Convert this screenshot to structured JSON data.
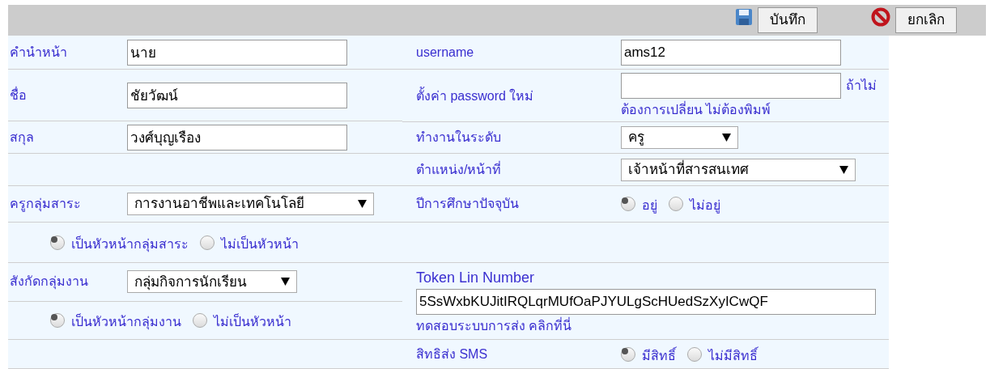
{
  "toolbar": {
    "save_label": "บันทึก",
    "cancel_label": "ยกเลิก"
  },
  "rows": [
    {
      "left": [
        {
          "kind": "field",
          "label": "คำนำหน้า",
          "control": {
            "kind": "input",
            "value": "นาย"
          }
        }
      ],
      "right": [
        {
          "kind": "field",
          "label": "username",
          "control": {
            "kind": "input",
            "value": "ams12"
          }
        }
      ]
    },
    {
      "left": [
        {
          "kind": "field",
          "label": "ชื่อ",
          "control": {
            "kind": "input",
            "value": "ชัยวัฒน์"
          }
        }
      ],
      "right": [
        {
          "kind": "field",
          "label": "ตั้งค่า password ใหม่",
          "control": {
            "kind": "password",
            "note": [
              "ถ้าไม่",
              "ต้องการเปลี่ยน ไม่ต้องพิมพ์"
            ]
          }
        }
      ]
    },
    {
      "left": [
        {
          "kind": "field",
          "label": "สกุล",
          "control": {
            "kind": "input",
            "value": "วงศ์บุญเรือง"
          }
        }
      ],
      "right": [
        {
          "kind": "field",
          "label": "ทำงานในระดับ",
          "control": {
            "kind": "select",
            "value": "ครู"
          }
        }
      ]
    },
    {
      "left": [
        {
          "kind": "empty"
        }
      ],
      "right": [
        {
          "kind": "field",
          "label": "ตำแหน่ง/หน้าที่",
          "control": {
            "kind": "select",
            "value": "เจ้าหน้าที่สารสนเทศ"
          }
        }
      ]
    },
    {
      "left": [
        {
          "kind": "field",
          "label": "ครูกลุ่มสาระ",
          "control": {
            "kind": "select",
            "value": "การงานอาชีพและเทคโนโลยี"
          }
        }
      ],
      "right": [
        {
          "kind": "field",
          "label": "ปีการศึกษาปัจจุบัน",
          "control": {
            "kind": "radios",
            "options": [
              {
                "label": "อยู่",
                "selected": true
              },
              {
                "label": "ไม่อยู่",
                "selected": false
              }
            ]
          }
        }
      ]
    },
    {
      "left": [
        {
          "kind": "radios",
          "options": [
            {
              "label": "เป็นหัวหน้ากลุ่มสาระ",
              "selected": true
            },
            {
              "label": "ไม่เป็นหัวหน้า",
              "selected": false
            }
          ]
        }
      ],
      "right": [
        {
          "kind": "empty"
        }
      ]
    },
    {
      "left": [
        {
          "kind": "field",
          "label": "สังกัดกลุ่มงาน",
          "control": {
            "kind": "select",
            "value": "กลุ่มกิจการนักเรียน"
          }
        },
        {
          "kind": "radios",
          "options": [
            {
              "label": "เป็นหัวหน้ากลุ่มงาน",
              "selected": true
            },
            {
              "label": "ไม่เป็นหัวหน้า",
              "selected": false
            }
          ]
        }
      ],
      "right": [
        {
          "kind": "token",
          "label": "Token Lin Number",
          "value": "5SsWxbKUJitIRQLqrMUfOaPJYULgScHUedSzXyICwQF",
          "link": "ทดสอบระบบการส่ง คลิกที่นี่"
        }
      ]
    },
    {
      "left": [
        {
          "kind": "empty"
        }
      ],
      "right": [
        {
          "kind": "field",
          "label": "สิทธิส่ง SMS",
          "control": {
            "kind": "radios",
            "options": [
              {
                "label": "มีสิทธิ์",
                "selected": true
              },
              {
                "label": "ไม่มีสิทธิ์",
                "selected": false
              }
            ]
          }
        }
      ]
    }
  ]
}
